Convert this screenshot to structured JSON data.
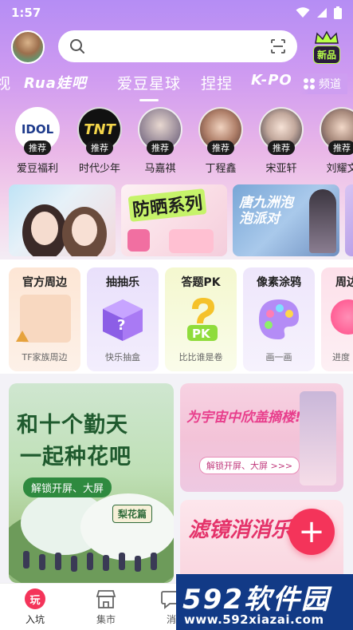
{
  "status_bar": {
    "time": "1:57"
  },
  "header": {
    "search_placeholder": "",
    "new_badge": "新品"
  },
  "tabs": [
    {
      "label": "视"
    },
    {
      "label": "Rua娃吧"
    },
    {
      "label": "爱豆星球",
      "active": true
    },
    {
      "label": "捏捏"
    },
    {
      "label": "K-PO"
    }
  ],
  "channel_label": "频道",
  "idols": [
    {
      "tag": "推荐",
      "name": "爱豆福利",
      "pic_text": "IDOL"
    },
    {
      "tag": "推荐",
      "name": "时代少年",
      "pic_text": "TNT"
    },
    {
      "tag": "推荐",
      "name": "马嘉祺"
    },
    {
      "tag": "推荐",
      "name": "丁程鑫"
    },
    {
      "tag": "推荐",
      "name": "宋亚轩"
    },
    {
      "tag": "推荐",
      "name": "刘耀文"
    }
  ],
  "banners": [
    {
      "text": ""
    },
    {
      "text": "防晒系列"
    },
    {
      "text": "唐九洲泡泡派对"
    }
  ],
  "categories": [
    {
      "title": "官方周边",
      "sub": "TF家族周边"
    },
    {
      "title": "抽抽乐",
      "sub": "快乐抽盒"
    },
    {
      "title": "答题PK",
      "sub": "比比谁是卷"
    },
    {
      "title": "像素涂鸦",
      "sub": "画一画"
    },
    {
      "title": "周边",
      "sub": "进度"
    }
  ],
  "feed": {
    "left": {
      "line1": "和十个勤天",
      "line2": "一起种花吧",
      "unlock": "解锁开屏、大屏",
      "tag": "梨花篇"
    },
    "right_top": {
      "title": "为宇宙中欣盖摘楼!",
      "unlock": "解锁开屏、大屏 >>>"
    },
    "right_bottom": {
      "title": "滤镜消消乐"
    }
  },
  "fab_label": "+",
  "bottom_nav": [
    {
      "label": "入坑",
      "icon_text": "玩",
      "active": true
    },
    {
      "label": "集市"
    },
    {
      "label": "消"
    }
  ],
  "watermark": {
    "big": "592软件园",
    "small": "www.592xiazai.com"
  },
  "colors": {
    "accent": "#f4345a",
    "tab_bg": "#b58df4",
    "watermark_bg": "#123a86"
  }
}
